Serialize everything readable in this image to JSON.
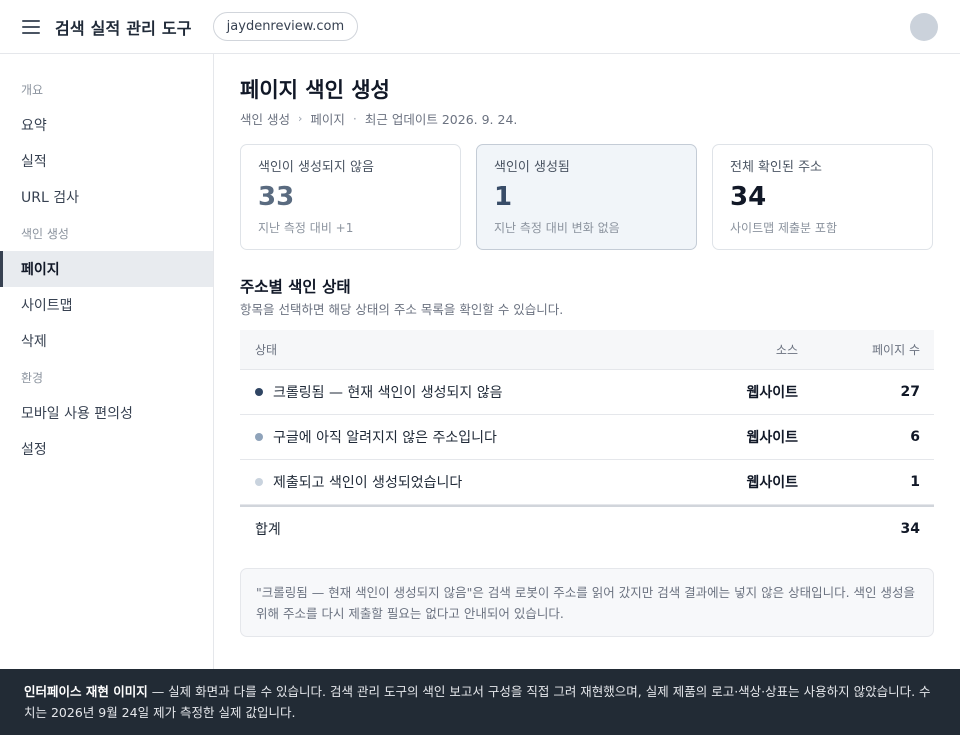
{
  "header": {
    "title": "검색 실적 관리 도구",
    "property": "jaydenreview.com"
  },
  "sidebar": {
    "sections": [
      {
        "label": "개요",
        "items": [
          {
            "label": "요약"
          },
          {
            "label": "실적"
          },
          {
            "label": "URL 검사"
          }
        ]
      },
      {
        "label": "색인 생성",
        "items": [
          {
            "label": "페이지",
            "active": true
          },
          {
            "label": "사이트맵"
          },
          {
            "label": "삭제"
          }
        ]
      },
      {
        "label": "환경",
        "items": [
          {
            "label": "모바일 사용 편의성"
          },
          {
            "label": "설정"
          }
        ]
      }
    ]
  },
  "main": {
    "title": "페이지 색인 생성",
    "breadcrumb": {
      "parent": "색인 생성",
      "current": "페이지",
      "updated": "최근 업데이트 2026. 9. 24."
    },
    "cards": [
      {
        "label": "색인이 생성되지 않음",
        "value": "33",
        "note": "지난 측정 대비 +1"
      },
      {
        "label": "색인이 생성됨",
        "value": "1",
        "note": "지난 측정 대비 변화 없음"
      },
      {
        "label": "전체 확인된 주소",
        "value": "34",
        "note": "사이트맵 제출분 포함"
      }
    ],
    "section_title": "주소별 색인 상태",
    "section_desc": "항목을 선택하면 해당 상태의 주소 목록을 확인할 수 있습니다.",
    "table": {
      "headers": {
        "status": "상태",
        "source": "소스",
        "count": "페이지 수"
      },
      "rows": [
        {
          "status": "크롤링됨 — 현재 색인이 생성되지 않음",
          "source": "웹사이트",
          "count": "27",
          "color": "#2f4563"
        },
        {
          "status": "구글에 아직 알려지지 않은 주소입니다",
          "source": "웹사이트",
          "count": "6",
          "color": "#8fa3ba"
        },
        {
          "status": "제출되고 색인이 생성되었습니다",
          "source": "웹사이트",
          "count": "1",
          "color": "#c9d3de"
        }
      ],
      "total_label": "합계",
      "total_value": "34"
    },
    "note": "\"크롤링됨 — 현재 색인이 생성되지 않음\"은 검색 로봇이 주소를 읽어 갔지만 검색 결과에는 넣지 않은 상태입니다. 색인 생성을 위해 주소를 다시 제출할 필요는 없다고 안내되어 있습니다."
  },
  "footer": {
    "bold": "인터페이스 재현 이미지",
    "text": " — 실제 화면과 다를 수 있습니다. 검색 관리 도구의 색인 보고서 구성을 직접 그려 재현했으며, 실제 제품의 로고·색상·상표는 사용하지 않았습니다. 수치는 2026년 9월 24일 제가 측정한 실제 값입니다."
  }
}
